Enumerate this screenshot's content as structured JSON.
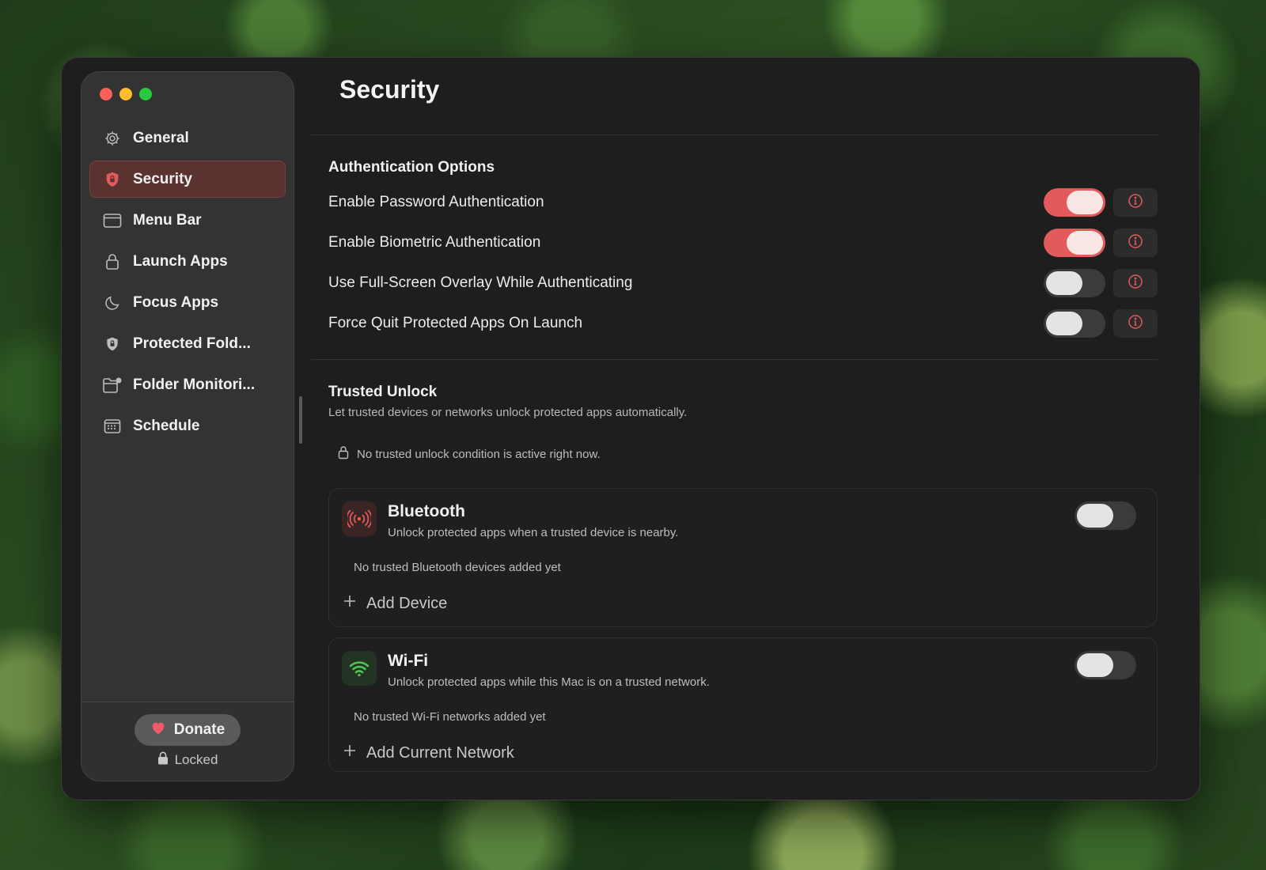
{
  "sidebar": {
    "items": [
      {
        "label": "General",
        "icon": "gear-icon"
      },
      {
        "label": "Security",
        "icon": "shield-icon",
        "active": true
      },
      {
        "label": "Menu Bar",
        "icon": "menu-bar-icon"
      },
      {
        "label": "Launch Apps",
        "icon": "lock-icon"
      },
      {
        "label": "Focus Apps",
        "icon": "moon-icon"
      },
      {
        "label": "Protected Fold...",
        "icon": "shield-lock-icon"
      },
      {
        "label": "Folder Monitori...",
        "icon": "folder-badge-icon"
      },
      {
        "label": "Schedule",
        "icon": "calendar-icon"
      }
    ],
    "donate_label": "Donate",
    "status_label": "Locked"
  },
  "main": {
    "title": "Security",
    "auth": {
      "title": "Authentication Options",
      "options": [
        {
          "label": "Enable Password Authentication",
          "enabled": true
        },
        {
          "label": "Enable Biometric Authentication",
          "enabled": true
        },
        {
          "label": "Use Full-Screen Overlay While Authenticating",
          "enabled": false
        },
        {
          "label": "Force Quit Protected Apps On Launch",
          "enabled": false
        }
      ]
    },
    "trusted": {
      "title": "Trusted Unlock",
      "subtitle": "Let trusted devices or networks unlock protected apps automatically.",
      "status": "No trusted unlock condition is active right now.",
      "bluetooth": {
        "title": "Bluetooth",
        "description": "Unlock protected apps when a trusted device is nearby.",
        "empty": "No trusted Bluetooth devices added yet",
        "add_label": "Add Device",
        "enabled": false
      },
      "wifi": {
        "title": "Wi-Fi",
        "description": "Unlock protected apps while this Mac is on a trusted network.",
        "empty": "No trusted Wi-Fi networks added yet",
        "add_label": "Add Current Network",
        "enabled": false
      }
    }
  },
  "colors": {
    "accent": "#e25b5b",
    "active_row": "#5a3330",
    "wifi_green": "#4cc552"
  }
}
